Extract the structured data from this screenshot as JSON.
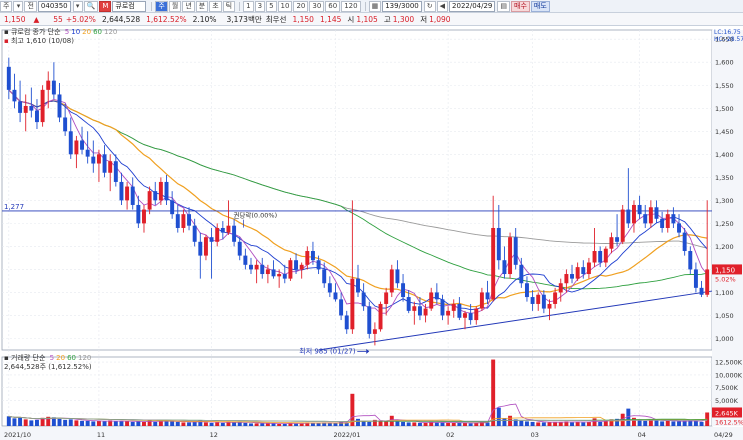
{
  "toolbar": {
    "type_select": "주",
    "market_select": "전",
    "code": "040350",
    "company": "큐로컴",
    "periods": [
      "주",
      "월",
      "년",
      "분",
      "초",
      "틱"
    ],
    "minutes": [
      "1",
      "3",
      "5",
      "10",
      "20",
      "30",
      "60",
      "120"
    ],
    "count": "139/3000",
    "date": "2022/04/29",
    "buy_label": "매수",
    "sell_label": "매도"
  },
  "quote": {
    "price": "1,150",
    "change_arrow": "▲",
    "change": "55",
    "change_pct": "+5.02%",
    "volume": "2,644,528",
    "volume_pct": "1,612.52%",
    "turnover": "2.10%",
    "amount": "3,173백만",
    "pref_label": "최우선",
    "ask": "1,150",
    "bid": "1,145",
    "high_label": "시",
    "open": "1,105",
    "high_name": "고",
    "high": "1,300",
    "low_name": "저",
    "low": "1,090"
  },
  "price_panel": {
    "legend_name": "큐로컴",
    "legend_ma": "종가 단순",
    "ma_periods": [
      "5",
      "10",
      "20",
      "60",
      "120"
    ],
    "ma_colors": [
      "#b04fc0",
      "#1f3fd0",
      "#f0a020",
      "#2fa040",
      "#9a9a9a"
    ],
    "high_marker": "최고 1,610 (10/08)",
    "low_marker": "최저 985 (01/27)",
    "div_label": "권당락(0.00%)",
    "h_line_label": "1,277",
    "right_labels": [
      "LC:16.75",
      "HC:-28.57"
    ],
    "price_tag": "1,150",
    "pct_tag": "5.02%",
    "y_ticks": [
      "1,650",
      "1,600",
      "1,550",
      "1,500",
      "1,450",
      "1,400",
      "1,350",
      "1,300",
      "1,250",
      "1,200",
      "1,150",
      "1,100",
      "1,050",
      "1,000"
    ]
  },
  "volume_panel": {
    "legend_name": "거래량",
    "legend_ma": "단순",
    "ma_periods": [
      "5",
      "20",
      "60",
      "120"
    ],
    "value": "2,644,528주 (1,612.52%)",
    "y_ticks": [
      "12,500K",
      "10,000K",
      "7,500K",
      "5,000K",
      "2,500K"
    ],
    "last_tag": "2,645K",
    "last_pct": "1612.5%"
  },
  "x_axis": [
    "2021/10",
    "11",
    "12",
    "2022/01",
    "02",
    "03",
    "04",
    "04/29"
  ],
  "chart_data": {
    "type": "candlestick",
    "ylim": [
      975,
      1670
    ],
    "volume_ylim": [
      0,
      13500
    ],
    "ma_periods": [
      5,
      10,
      20,
      60,
      120
    ],
    "horizontal_line": 1277,
    "candles": [
      {
        "o": 1590,
        "h": 1610,
        "l": 1520,
        "c": 1540,
        "v": 1900
      },
      {
        "o": 1540,
        "h": 1575,
        "l": 1500,
        "c": 1515,
        "v": 1500
      },
      {
        "o": 1515,
        "h": 1560,
        "l": 1470,
        "c": 1490,
        "v": 1700
      },
      {
        "o": 1490,
        "h": 1530,
        "l": 1450,
        "c": 1505,
        "v": 1300
      },
      {
        "o": 1505,
        "h": 1545,
        "l": 1480,
        "c": 1495,
        "v": 1100
      },
      {
        "o": 1495,
        "h": 1520,
        "l": 1455,
        "c": 1470,
        "v": 1200
      },
      {
        "o": 1470,
        "h": 1550,
        "l": 1460,
        "c": 1540,
        "v": 1600
      },
      {
        "o": 1540,
        "h": 1580,
        "l": 1500,
        "c": 1560,
        "v": 1800
      },
      {
        "o": 1560,
        "h": 1600,
        "l": 1520,
        "c": 1530,
        "v": 1700
      },
      {
        "o": 1530,
        "h": 1555,
        "l": 1470,
        "c": 1480,
        "v": 1400
      },
      {
        "o": 1480,
        "h": 1510,
        "l": 1440,
        "c": 1450,
        "v": 1200
      },
      {
        "o": 1450,
        "h": 1480,
        "l": 1390,
        "c": 1400,
        "v": 1300
      },
      {
        "o": 1400,
        "h": 1440,
        "l": 1370,
        "c": 1430,
        "v": 1100
      },
      {
        "o": 1430,
        "h": 1460,
        "l": 1400,
        "c": 1410,
        "v": 1000
      },
      {
        "o": 1410,
        "h": 1450,
        "l": 1380,
        "c": 1395,
        "v": 1000
      },
      {
        "o": 1395,
        "h": 1430,
        "l": 1360,
        "c": 1380,
        "v": 900
      },
      {
        "o": 1380,
        "h": 1410,
        "l": 1340,
        "c": 1400,
        "v": 1000
      },
      {
        "o": 1400,
        "h": 1420,
        "l": 1350,
        "c": 1360,
        "v": 900
      },
      {
        "o": 1360,
        "h": 1400,
        "l": 1320,
        "c": 1385,
        "v": 1100
      },
      {
        "o": 1385,
        "h": 1400,
        "l": 1330,
        "c": 1340,
        "v": 900
      },
      {
        "o": 1340,
        "h": 1360,
        "l": 1290,
        "c": 1300,
        "v": 1000
      },
      {
        "o": 1300,
        "h": 1340,
        "l": 1280,
        "c": 1330,
        "v": 900
      },
      {
        "o": 1330,
        "h": 1350,
        "l": 1280,
        "c": 1290,
        "v": 800
      },
      {
        "o": 1290,
        "h": 1310,
        "l": 1240,
        "c": 1250,
        "v": 900
      },
      {
        "o": 1250,
        "h": 1290,
        "l": 1230,
        "c": 1280,
        "v": 800
      },
      {
        "o": 1280,
        "h": 1330,
        "l": 1270,
        "c": 1320,
        "v": 1200
      },
      {
        "o": 1320,
        "h": 1340,
        "l": 1290,
        "c": 1300,
        "v": 800
      },
      {
        "o": 1300,
        "h": 1350,
        "l": 1290,
        "c": 1340,
        "v": 1000
      },
      {
        "o": 1340,
        "h": 1355,
        "l": 1290,
        "c": 1300,
        "v": 900
      },
      {
        "o": 1300,
        "h": 1320,
        "l": 1260,
        "c": 1270,
        "v": 900
      },
      {
        "o": 1270,
        "h": 1290,
        "l": 1230,
        "c": 1240,
        "v": 800
      },
      {
        "o": 1240,
        "h": 1280,
        "l": 1230,
        "c": 1270,
        "v": 700
      },
      {
        "o": 1270,
        "h": 1285,
        "l": 1235,
        "c": 1245,
        "v": 700
      },
      {
        "o": 1245,
        "h": 1260,
        "l": 1200,
        "c": 1210,
        "v": 800
      },
      {
        "o": 1210,
        "h": 1230,
        "l": 1130,
        "c": 1180,
        "v": 1100
      },
      {
        "o": 1180,
        "h": 1225,
        "l": 1170,
        "c": 1220,
        "v": 700
      },
      {
        "o": 1220,
        "h": 1240,
        "l": 1130,
        "c": 1210,
        "v": 600
      },
      {
        "o": 1210,
        "h": 1250,
        "l": 1200,
        "c": 1240,
        "v": 700
      },
      {
        "o": 1240,
        "h": 1255,
        "l": 1215,
        "c": 1230,
        "v": 600
      },
      {
        "o": 1230,
        "h": 1300,
        "l": 1225,
        "c": 1245,
        "v": 900
      },
      {
        "o": 1245,
        "h": 1260,
        "l": 1200,
        "c": 1210,
        "v": 800
      },
      {
        "o": 1210,
        "h": 1220,
        "l": 1170,
        "c": 1180,
        "v": 700
      },
      {
        "o": 1180,
        "h": 1195,
        "l": 1150,
        "c": 1160,
        "v": 600
      },
      {
        "o": 1160,
        "h": 1175,
        "l": 1140,
        "c": 1150,
        "v": 500
      },
      {
        "o": 1150,
        "h": 1170,
        "l": 1120,
        "c": 1160,
        "v": 500
      },
      {
        "o": 1160,
        "h": 1175,
        "l": 1130,
        "c": 1140,
        "v": 500
      },
      {
        "o": 1140,
        "h": 1160,
        "l": 1120,
        "c": 1150,
        "v": 500
      },
      {
        "o": 1150,
        "h": 1170,
        "l": 1130,
        "c": 1135,
        "v": 500
      },
      {
        "o": 1135,
        "h": 1150,
        "l": 1110,
        "c": 1140,
        "v": 400
      },
      {
        "o": 1140,
        "h": 1160,
        "l": 1120,
        "c": 1130,
        "v": 400
      },
      {
        "o": 1130,
        "h": 1175,
        "l": 1125,
        "c": 1170,
        "v": 600
      },
      {
        "o": 1170,
        "h": 1185,
        "l": 1140,
        "c": 1150,
        "v": 500
      },
      {
        "o": 1150,
        "h": 1165,
        "l": 1130,
        "c": 1160,
        "v": 500
      },
      {
        "o": 1160,
        "h": 1200,
        "l": 1150,
        "c": 1190,
        "v": 700
      },
      {
        "o": 1190,
        "h": 1210,
        "l": 1160,
        "c": 1170,
        "v": 600
      },
      {
        "o": 1170,
        "h": 1180,
        "l": 1140,
        "c": 1150,
        "v": 500
      },
      {
        "o": 1150,
        "h": 1165,
        "l": 1110,
        "c": 1120,
        "v": 700
      },
      {
        "o": 1120,
        "h": 1135,
        "l": 1090,
        "c": 1100,
        "v": 600
      },
      {
        "o": 1100,
        "h": 1120,
        "l": 1080,
        "c": 1085,
        "v": 600
      },
      {
        "o": 1085,
        "h": 1100,
        "l": 1040,
        "c": 1050,
        "v": 800
      },
      {
        "o": 1050,
        "h": 1060,
        "l": 1010,
        "c": 1020,
        "v": 700
      },
      {
        "o": 1020,
        "h": 1300,
        "l": 1010,
        "c": 1130,
        "v": 6300
      },
      {
        "o": 1130,
        "h": 1160,
        "l": 1090,
        "c": 1100,
        "v": 1400
      },
      {
        "o": 1100,
        "h": 1120,
        "l": 1060,
        "c": 1070,
        "v": 900
      },
      {
        "o": 1070,
        "h": 1080,
        "l": 1000,
        "c": 1010,
        "v": 800
      },
      {
        "o": 1010,
        "h": 1035,
        "l": 985,
        "c": 1020,
        "v": 1200
      },
      {
        "o": 1020,
        "h": 1080,
        "l": 1015,
        "c": 1075,
        "v": 1100
      },
      {
        "o": 1075,
        "h": 1110,
        "l": 1050,
        "c": 1100,
        "v": 1000
      },
      {
        "o": 1100,
        "h": 1160,
        "l": 1090,
        "c": 1150,
        "v": 2000
      },
      {
        "o": 1150,
        "h": 1170,
        "l": 1110,
        "c": 1120,
        "v": 900
      },
      {
        "o": 1120,
        "h": 1140,
        "l": 1080,
        "c": 1090,
        "v": 800
      },
      {
        "o": 1090,
        "h": 1105,
        "l": 1055,
        "c": 1060,
        "v": 700
      },
      {
        "o": 1060,
        "h": 1080,
        "l": 1030,
        "c": 1070,
        "v": 700
      },
      {
        "o": 1070,
        "h": 1090,
        "l": 1040,
        "c": 1050,
        "v": 600
      },
      {
        "o": 1050,
        "h": 1075,
        "l": 1035,
        "c": 1065,
        "v": 600
      },
      {
        "o": 1065,
        "h": 1110,
        "l": 1060,
        "c": 1100,
        "v": 800
      },
      {
        "o": 1100,
        "h": 1120,
        "l": 1075,
        "c": 1085,
        "v": 700
      },
      {
        "o": 1085,
        "h": 1095,
        "l": 1040,
        "c": 1050,
        "v": 700
      },
      {
        "o": 1050,
        "h": 1070,
        "l": 1030,
        "c": 1060,
        "v": 600
      },
      {
        "o": 1060,
        "h": 1085,
        "l": 1045,
        "c": 1075,
        "v": 600
      },
      {
        "o": 1075,
        "h": 1090,
        "l": 1040,
        "c": 1045,
        "v": 600
      },
      {
        "o": 1045,
        "h": 1060,
        "l": 1020,
        "c": 1055,
        "v": 600
      },
      {
        "o": 1055,
        "h": 1075,
        "l": 1030,
        "c": 1040,
        "v": 500
      },
      {
        "o": 1040,
        "h": 1070,
        "l": 1030,
        "c": 1065,
        "v": 600
      },
      {
        "o": 1065,
        "h": 1110,
        "l": 1060,
        "c": 1100,
        "v": 800
      },
      {
        "o": 1100,
        "h": 1125,
        "l": 1075,
        "c": 1085,
        "v": 700
      },
      {
        "o": 1085,
        "h": 1310,
        "l": 1080,
        "c": 1240,
        "v": 13000
      },
      {
        "o": 1240,
        "h": 1290,
        "l": 1150,
        "c": 1170,
        "v": 3600
      },
      {
        "o": 1170,
        "h": 1200,
        "l": 1130,
        "c": 1140,
        "v": 1500
      },
      {
        "o": 1140,
        "h": 1230,
        "l": 1130,
        "c": 1220,
        "v": 2000
      },
      {
        "o": 1220,
        "h": 1240,
        "l": 1150,
        "c": 1160,
        "v": 1300
      },
      {
        "o": 1160,
        "h": 1175,
        "l": 1110,
        "c": 1120,
        "v": 1000
      },
      {
        "o": 1120,
        "h": 1135,
        "l": 1080,
        "c": 1090,
        "v": 900
      },
      {
        "o": 1090,
        "h": 1105,
        "l": 1060,
        "c": 1075,
        "v": 800
      },
      {
        "o": 1075,
        "h": 1100,
        "l": 1060,
        "c": 1095,
        "v": 700
      },
      {
        "o": 1095,
        "h": 1105,
        "l": 1055,
        "c": 1065,
        "v": 700
      },
      {
        "o": 1065,
        "h": 1085,
        "l": 1040,
        "c": 1075,
        "v": 700
      },
      {
        "o": 1075,
        "h": 1110,
        "l": 1065,
        "c": 1100,
        "v": 800
      },
      {
        "o": 1100,
        "h": 1130,
        "l": 1080,
        "c": 1120,
        "v": 800
      },
      {
        "o": 1120,
        "h": 1150,
        "l": 1100,
        "c": 1140,
        "v": 900
      },
      {
        "o": 1140,
        "h": 1160,
        "l": 1120,
        "c": 1130,
        "v": 700
      },
      {
        "o": 1130,
        "h": 1165,
        "l": 1125,
        "c": 1155,
        "v": 800
      },
      {
        "o": 1155,
        "h": 1170,
        "l": 1130,
        "c": 1140,
        "v": 700
      },
      {
        "o": 1140,
        "h": 1175,
        "l": 1130,
        "c": 1165,
        "v": 800
      },
      {
        "o": 1165,
        "h": 1240,
        "l": 1155,
        "c": 1190,
        "v": 1500
      },
      {
        "o": 1190,
        "h": 1200,
        "l": 1155,
        "c": 1165,
        "v": 800
      },
      {
        "o": 1165,
        "h": 1200,
        "l": 1155,
        "c": 1195,
        "v": 900
      },
      {
        "o": 1195,
        "h": 1230,
        "l": 1185,
        "c": 1220,
        "v": 1300
      },
      {
        "o": 1220,
        "h": 1270,
        "l": 1200,
        "c": 1210,
        "v": 1400
      },
      {
        "o": 1210,
        "h": 1290,
        "l": 1205,
        "c": 1280,
        "v": 2400
      },
      {
        "o": 1280,
        "h": 1370,
        "l": 1240,
        "c": 1250,
        "v": 3400
      },
      {
        "o": 1250,
        "h": 1300,
        "l": 1230,
        "c": 1290,
        "v": 1600
      },
      {
        "o": 1290,
        "h": 1310,
        "l": 1260,
        "c": 1270,
        "v": 1200
      },
      {
        "o": 1270,
        "h": 1290,
        "l": 1240,
        "c": 1250,
        "v": 1000
      },
      {
        "o": 1250,
        "h": 1300,
        "l": 1240,
        "c": 1285,
        "v": 1300
      },
      {
        "o": 1285,
        "h": 1300,
        "l": 1250,
        "c": 1260,
        "v": 1100
      },
      {
        "o": 1260,
        "h": 1275,
        "l": 1230,
        "c": 1240,
        "v": 900
      },
      {
        "o": 1240,
        "h": 1280,
        "l": 1230,
        "c": 1270,
        "v": 1000
      },
      {
        "o": 1270,
        "h": 1285,
        "l": 1240,
        "c": 1250,
        "v": 900
      },
      {
        "o": 1250,
        "h": 1270,
        "l": 1220,
        "c": 1230,
        "v": 900
      },
      {
        "o": 1230,
        "h": 1240,
        "l": 1180,
        "c": 1190,
        "v": 1000
      },
      {
        "o": 1190,
        "h": 1200,
        "l": 1140,
        "c": 1150,
        "v": 1100
      },
      {
        "o": 1150,
        "h": 1165,
        "l": 1100,
        "c": 1110,
        "v": 1000
      },
      {
        "o": 1110,
        "h": 1125,
        "l": 1090,
        "c": 1095,
        "v": 800
      },
      {
        "o": 1095,
        "h": 1300,
        "l": 1090,
        "c": 1150,
        "v": 2645
      }
    ]
  }
}
